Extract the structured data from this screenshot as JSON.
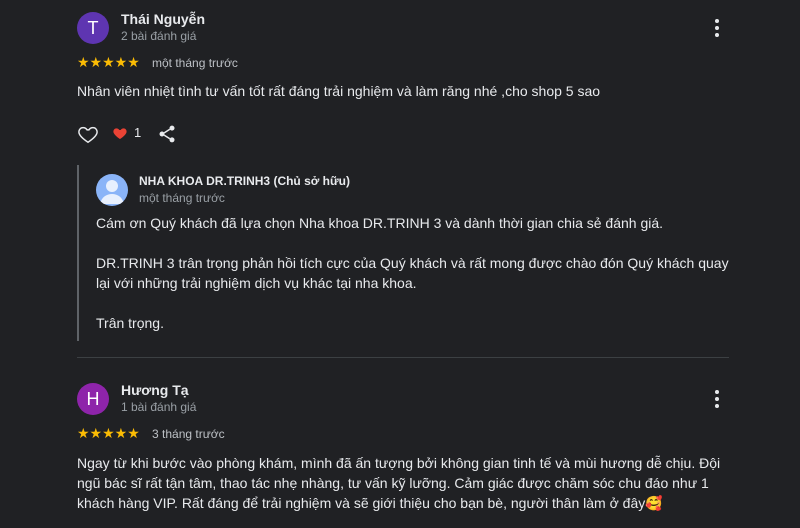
{
  "reviews": [
    {
      "initial": "T",
      "avatar_color": "#5e35b1",
      "name": "Thái Nguyễn",
      "reviews_count": "2 bài đánh giá",
      "stars": "★★★★★",
      "time": "một tháng trước",
      "text": "Nhân viên nhiệt tình tư vấn tốt rất đáng trải nghiệm và làm răng nhé ,cho shop 5 sao",
      "like_count": "1"
    },
    {
      "initial": "H",
      "avatar_color": "#8e24aa",
      "name": "Hương Tạ",
      "reviews_count": "1 bài đánh giá",
      "stars": "★★★★★",
      "time": "3 tháng trước",
      "text_lines": [
        "Ngay từ khi bước vào phòng khám, mình đã ấn tượng bởi không gian tinh tế và mùi hương dễ chịu. Đội",
        "ngũ bác sĩ rất tận tâm, thao tác nhẹ nhàng, tư vấn kỹ lưỡng. Cảm giác được chăm sóc chu đáo như 1",
        "khách hàng VIP. Rất đáng để trải nghiệm và sẽ giới thiệu cho bạn bè, người thân làm ở đây🥰"
      ]
    }
  ],
  "owner_reply": {
    "name": "NHA KHOA DR.TRINH3 (Chủ sở hữu)",
    "time": "một tháng trước",
    "p1": "Cám ơn Quý khách đã lựa chọn Nha khoa DR.TRINH 3 và dành thời gian chia sẻ đánh giá.",
    "p2_line1": "DR.TRINH 3 trân trọng phản hồi tích cực của Quý khách và rất mong được chào đón Quý khách quay",
    "p2_line2": "lại với những trải nghiệm dịch vụ khác tại nha khoa.",
    "p3": "Trân trọng."
  },
  "colors": {
    "star": "#fbbc04",
    "heart": "#ea4335",
    "owner_avatar": "#8ab4f8"
  }
}
